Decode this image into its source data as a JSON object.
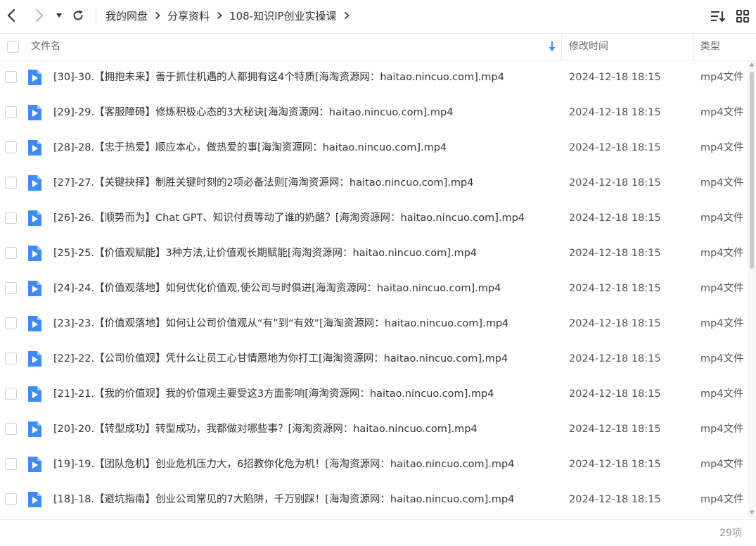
{
  "toolbar": {
    "back_icon": "chevron-left-icon",
    "forward_icon": "chevron-right-icon",
    "history_icon": "caret-down-icon",
    "refresh_icon": "refresh-icon",
    "sort_icon": "sort-list-icon",
    "view_icon": "grid-view-icon"
  },
  "breadcrumb": [
    "我的网盘",
    "分享资料",
    "108-知识IP创业实操课"
  ],
  "header": {
    "name": "文件名",
    "date": "修改时间",
    "type": "类型",
    "sort_icon": "sort-down-arrow-icon"
  },
  "files": [
    {
      "name": "[30]-30.【拥抱未来】善于抓住机遇的人都拥有这4个特质[海淘资源网：haitao.nincuo.com].mp4",
      "date": "2024-12-18 18:15",
      "type": "mp4文件"
    },
    {
      "name": "[29]-29.【客服障碍】修炼积极心态的3大秘诀[海淘资源网：haitao.nincuo.com].mp4",
      "date": "2024-12-18 18:15",
      "type": "mp4文件"
    },
    {
      "name": "[28]-28.【忠于热爱】顺应本心，做热爱的事[海淘资源网：haitao.nincuo.com].mp4",
      "date": "2024-12-18 18:15",
      "type": "mp4文件"
    },
    {
      "name": "[27]-27.【关键抉择】制胜关键时刻的2项必备法则[海淘资源网：haitao.nincuo.com].mp4",
      "date": "2024-12-18 18:15",
      "type": "mp4文件"
    },
    {
      "name": "[26]-26.【顺势而为】Chat GPT、知识付费等动了谁的奶酪？[海淘资源网：haitao.nincuo.com].mp4",
      "date": "2024-12-18 18:15",
      "type": "mp4文件"
    },
    {
      "name": "[25]-25.【价值观赋能】3种方法,让价值观长期赋能[海淘资源网：haitao.nincuo.com].mp4",
      "date": "2024-12-18 18:15",
      "type": "mp4文件"
    },
    {
      "name": "[24]-24.【价值观落地】如何优化价值观,使公司与时俱进[海淘资源网：haitao.nincuo.com].mp4",
      "date": "2024-12-18 18:15",
      "type": "mp4文件"
    },
    {
      "name": "[23]-23.【价值观落地】如何让公司价值观从“有”到“有效”[海淘资源网：haitao.nincuo.com].mp4",
      "date": "2024-12-18 18:15",
      "type": "mp4文件"
    },
    {
      "name": "[22]-22.【公司价值观】凭什么让员工心甘情愿地为你打工[海淘资源网：haitao.nincuo.com].mp4",
      "date": "2024-12-18 18:15",
      "type": "mp4文件"
    },
    {
      "name": "[21]-21.【我的价值观】我的价值观主要受这3方面影响[海淘资源网：haitao.nincuo.com].mp4",
      "date": "2024-12-18 18:15",
      "type": "mp4文件"
    },
    {
      "name": "[20]-20.【转型成功】转型成功，我都做对哪些事？[海淘资源网：haitao.nincuo.com].mp4",
      "date": "2024-12-18 18:15",
      "type": "mp4文件"
    },
    {
      "name": "[19]-19.【团队危机】创业危机压力大，6招教你化危为机！[海淘资源网：haitao.nincuo.com].mp4",
      "date": "2024-12-18 18:15",
      "type": "mp4文件"
    },
    {
      "name": "[18]-18.【避坑指南】创业公司常见的7大陷阱，千万别踩！[海淘资源网：haitao.nincuo.com].mp4",
      "date": "2024-12-18 18:15",
      "type": "mp4文件"
    }
  ],
  "file_icon": "video-file-icon",
  "footer": {
    "count": "29项"
  },
  "colors": {
    "accent": "#3d8bf5",
    "text": "#333333",
    "muted": "#999999",
    "border": "#ececec"
  }
}
